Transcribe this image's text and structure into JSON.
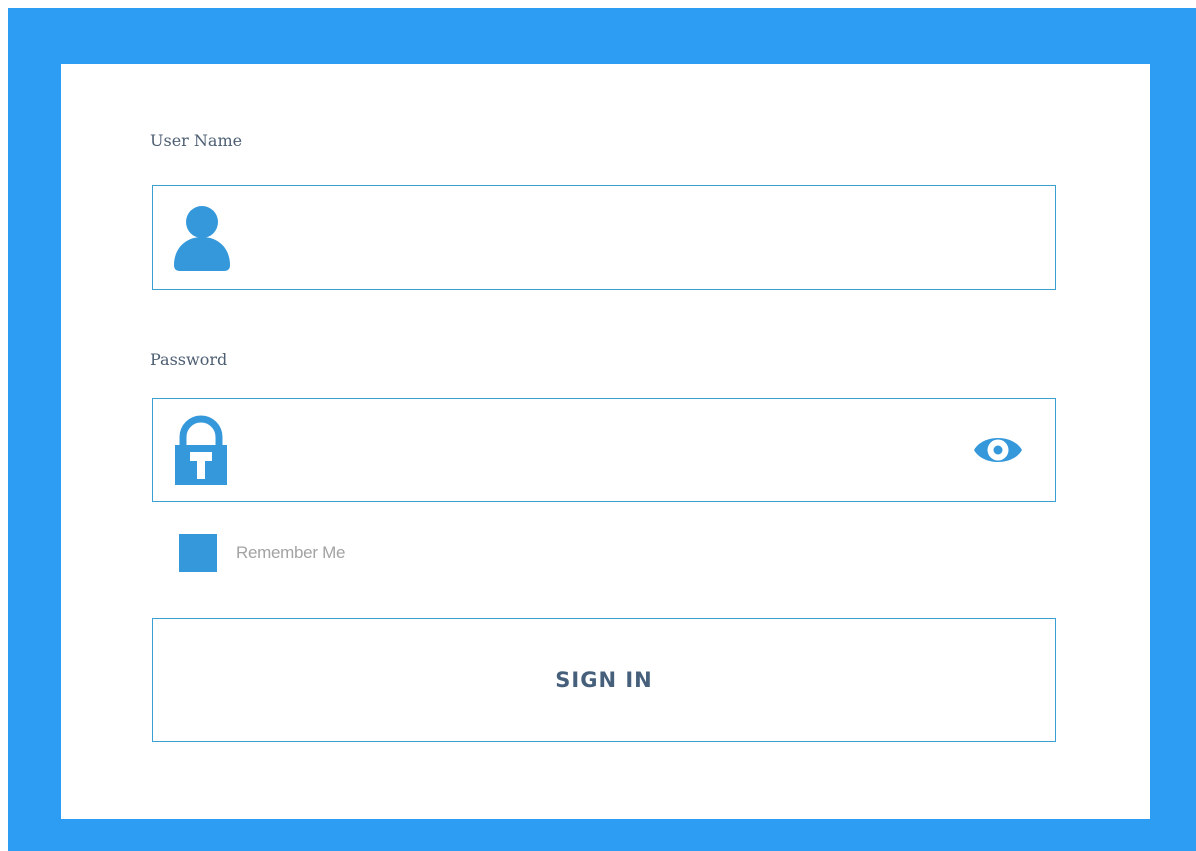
{
  "form": {
    "username": {
      "label": "User Name",
      "value": "",
      "placeholder": "",
      "icon": "user-icon"
    },
    "password": {
      "label": "Password",
      "value": "",
      "placeholder": "",
      "icon": "lock-icon",
      "toggle_icon": "eye-icon"
    },
    "remember": {
      "label": "Remember Me",
      "checked": false
    },
    "submit_label": "SIGN IN"
  },
  "colors": {
    "frame": "#2d9df3",
    "card": "#ffffff",
    "icon": "#3498db",
    "input_border": "#3a9fd0",
    "label_text": "#4d5e73",
    "button_text": "#46607c",
    "muted_text": "#a3a3a3"
  }
}
